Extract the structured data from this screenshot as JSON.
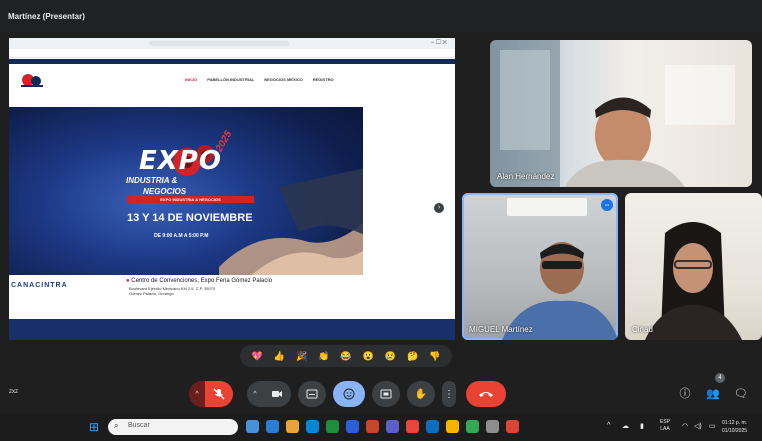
{
  "window": {
    "title": "Martínez (Presentar)"
  },
  "presentation": {
    "site_menu": [
      "INICIO",
      "PABELLÓN INDUSTRIAL",
      "NEGOCIOS MEXICO",
      "REGISTRO"
    ],
    "banner": {
      "title": "EXPO",
      "year": "2025",
      "subtitle_1": "INDUSTRIA &",
      "subtitle_2": "NEGOCIOS",
      "ribbon": "EXPO INDUSTRIA & NEGOCIOS",
      "dates": "13 Y 14 DE NOVIEMBRE",
      "hours": "DE 9:00 A.M A 5:00 P.M",
      "venue": "Centro de Convenciones, Expo Feria Gómez Palacio",
      "address_1": "Boulevard Ejército Mexicano KM 2.5, C.P. 35070",
      "address_2": "Gómez Palacio, Durango",
      "sponsor": "CANACINTRA"
    },
    "colors": {
      "brand_red": "#d3232a",
      "brand_navy": "#122a5a"
    }
  },
  "participants": [
    {
      "name": "Alan Hernández"
    },
    {
      "name": "MIGUEL Martínez",
      "badge": "•••"
    },
    {
      "name": "Cinad"
    }
  ],
  "reactions": [
    "💖",
    "👍",
    "🎉",
    "👏",
    "😂",
    "😮",
    "😢",
    "🤔",
    "👎"
  ],
  "controls": {
    "meeting_code": "zxz",
    "mic_icon": "mic-off-icon",
    "people_count": "4"
  },
  "taskbar": {
    "search_placeholder": "Buscar",
    "language": "ESP",
    "language_sub": "LAA",
    "time": "01:12 p. m.",
    "date": "01/10/2025"
  }
}
